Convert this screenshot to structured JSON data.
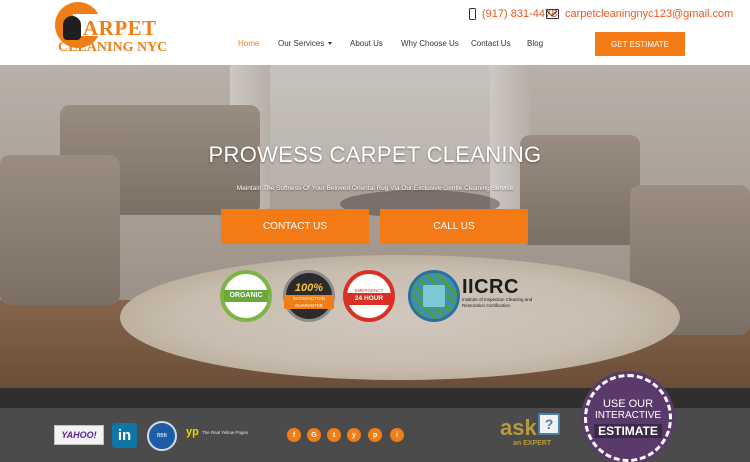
{
  "brand": {
    "logo_line1": "ARPET",
    "logo_line2": "CLEANING NYC"
  },
  "header": {
    "phone": "(917) 831-4478",
    "email": "carpetcleaningnyc123@gmail.com",
    "cta_label": "GET ESTIMATE"
  },
  "nav": {
    "items": [
      {
        "label": "Home",
        "active": true
      },
      {
        "label": "Our Services",
        "has_dropdown": true
      },
      {
        "label": "About Us"
      },
      {
        "label": "Why Choose Us"
      },
      {
        "label": "Contact Us"
      },
      {
        "label": "Blog"
      }
    ]
  },
  "hero": {
    "title": "PROWESS CARPET CLEANING",
    "subtitle": "Maintain The Softness Of Your Beloved Oriental Rug Via Our Exclusive Gentle Cleaning Service",
    "contact_button": "CONTACT US",
    "call_button": "CALL US"
  },
  "badges": {
    "organic": "ORGANIC",
    "satisfaction_pct": "100%",
    "satisfaction_label": "SATISFACTION GUARANTEE",
    "hour_top": "EMERGENCY",
    "hour_label": "24 HOUR",
    "iicrc_title": "IICRC",
    "iicrc_sub": "Institute of Inspection Cleaning and Restoration Certification"
  },
  "footer": {
    "yahoo": "YAHOO!",
    "linkedin": "in",
    "bbb": "BBB",
    "yp_mark": "yp",
    "yp_sub": "The Real Yellow Pages",
    "social": [
      "f",
      "G",
      "t",
      "y",
      "p",
      "i"
    ],
    "ask": "ask",
    "ask_expert": "an EXPERT",
    "interactive_l1": "USE OUR",
    "interactive_l2": "INTERACTIVE",
    "interactive_l3": "ESTIMATE"
  },
  "colors": {
    "accent": "#f47a16",
    "footer_bg": "#4b4b4b",
    "footer_top": "#2f2f2f"
  }
}
